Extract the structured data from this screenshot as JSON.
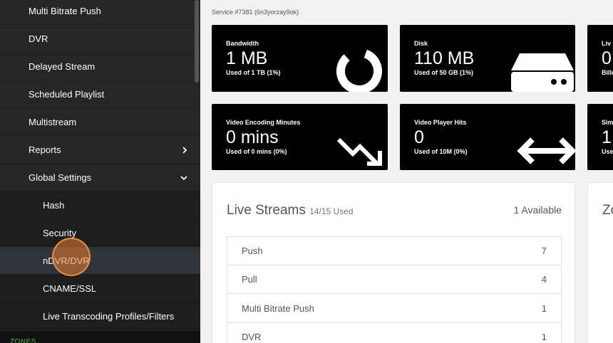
{
  "sidebar": {
    "items": [
      {
        "label": "Multi Bitrate Push"
      },
      {
        "label": "DVR"
      },
      {
        "label": "Delayed Stream"
      },
      {
        "label": "Scheduled Playlist"
      },
      {
        "label": "Multistream"
      },
      {
        "label": "Reports"
      },
      {
        "label": "Global Settings"
      }
    ],
    "global_settings_sub": [
      {
        "label": "Hash"
      },
      {
        "label": "Security"
      },
      {
        "label": "nDVR/DVR"
      },
      {
        "label": "CNAME/SSL"
      },
      {
        "label": "Live Transcoding Profiles/Filters"
      }
    ],
    "zones_label": "ZONES"
  },
  "main": {
    "service_id": "Service #7381 (6n3yorzay9ok)",
    "stats": [
      {
        "label": "Bandwidth",
        "value": "1 MB",
        "sub": "Used of 1 TB (1%)",
        "icon": "donut-chart-icon"
      },
      {
        "label": "Disk",
        "value": "110 MB",
        "sub": "Used of 50 GB (1%)",
        "icon": "hard-drive-icon"
      },
      {
        "label": "Liv",
        "value": "0",
        "sub": "Bille",
        "icon": ""
      },
      {
        "label": "Video Encoding Minutes",
        "value": "0 mins",
        "sub": "Used of 0 mins (0%)",
        "icon": "trend-down-icon"
      },
      {
        "label": "Video Player Hits",
        "value": "0",
        "sub": "Used of 10M (0%)",
        "icon": "double-arrow-icon"
      },
      {
        "label": "Sim",
        "value": "1",
        "sub": "Use",
        "icon": ""
      }
    ],
    "live_streams": {
      "title": "Live Streams",
      "used": "14/15 Used",
      "available": "1 Available",
      "rows": [
        {
          "name": "Push",
          "count": "7"
        },
        {
          "name": "Pull",
          "count": "4"
        },
        {
          "name": "Multi Bitrate Push",
          "count": "1"
        },
        {
          "name": "DVR",
          "count": "1"
        }
      ]
    },
    "zones_panel": {
      "title": "Zo"
    }
  }
}
